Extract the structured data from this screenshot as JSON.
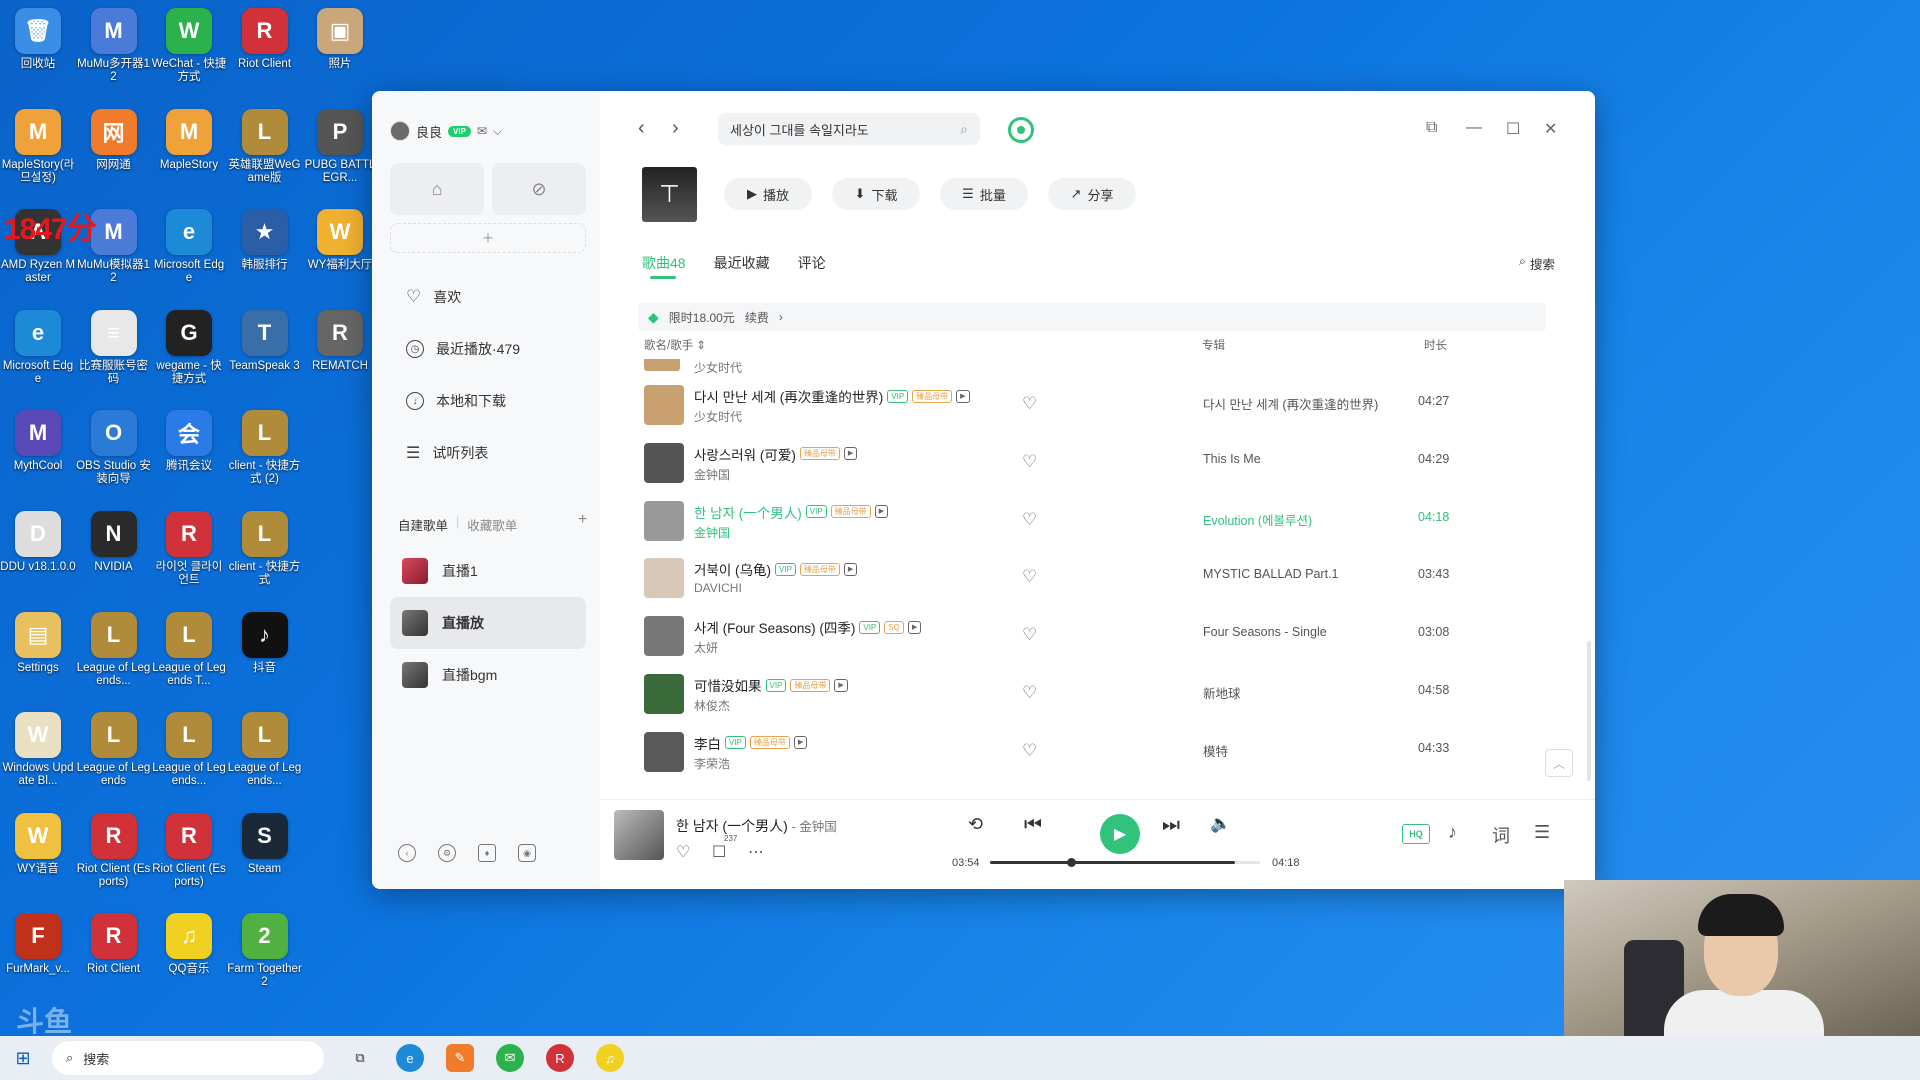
{
  "desktop": {
    "overlay_time": "1847分",
    "icons": [
      {
        "label": "回收站",
        "col": 0,
        "row": 0,
        "color": "#3a8ee6",
        "glyph": "🗑"
      },
      {
        "label": "MuMu多开器12",
        "col": 1,
        "row": 0,
        "color": "#4a7bd8",
        "glyph": "M"
      },
      {
        "label": "WeChat - 快捷方式",
        "col": 2,
        "row": 0,
        "color": "#2bb24c",
        "glyph": "W"
      },
      {
        "label": "Riot Client",
        "col": 3,
        "row": 0,
        "color": "#d1323a",
        "glyph": "R"
      },
      {
        "label": "照片",
        "col": 4,
        "row": 0,
        "color": "#c8a87a",
        "glyph": "▣"
      },
      {
        "label": "MapleStory(라므설정)",
        "col": 0,
        "row": 1,
        "color": "#f0a23a",
        "glyph": "M"
      },
      {
        "label": "网网通",
        "col": 1,
        "row": 1,
        "color": "#f07b2a",
        "glyph": "网"
      },
      {
        "label": "MapleStory",
        "col": 2,
        "row": 1,
        "color": "#f0a23a",
        "glyph": "M"
      },
      {
        "label": "英雄联盟WeGame版",
        "col": 3,
        "row": 1,
        "color": "#b08b3a",
        "glyph": "L"
      },
      {
        "label": "PUBG BATTLEGR...",
        "col": 4,
        "row": 1,
        "color": "#555",
        "glyph": "P"
      },
      {
        "label": "AMD Ryzen Master",
        "col": 0,
        "row": 2,
        "color": "#333",
        "glyph": "A"
      },
      {
        "label": "MuMu模拟器12",
        "col": 1,
        "row": 2,
        "color": "#4a7bd8",
        "glyph": "M"
      },
      {
        "label": "Microsoft Edge",
        "col": 2,
        "row": 2,
        "color": "#1d8ad8",
        "glyph": "e"
      },
      {
        "label": "韩服排行",
        "col": 3,
        "row": 2,
        "color": "#2a5fa8",
        "glyph": "★"
      },
      {
        "label": "WY福利大厅",
        "col": 4,
        "row": 2,
        "color": "#f0b030",
        "glyph": "W"
      },
      {
        "label": "Microsoft Edge",
        "col": 0,
        "row": 3,
        "color": "#1d8ad8",
        "glyph": "e"
      },
      {
        "label": "比赛服账号密码",
        "col": 1,
        "row": 3,
        "color": "#e8e8e8",
        "glyph": "≡"
      },
      {
        "label": "wegame - 快捷方式",
        "col": 2,
        "row": 3,
        "color": "#222",
        "glyph": "G"
      },
      {
        "label": "TeamSpeak 3",
        "col": 3,
        "row": 3,
        "color": "#3a6ea8",
        "glyph": "T"
      },
      {
        "label": "REMATCH",
        "col": 4,
        "row": 3,
        "color": "#666",
        "glyph": "R"
      },
      {
        "label": "MythCool",
        "col": 0,
        "row": 4,
        "color": "#5a4ab8",
        "glyph": "M"
      },
      {
        "label": "OBS Studio 安装向导",
        "col": 1,
        "row": 4,
        "color": "#2a7ad8",
        "glyph": "O"
      },
      {
        "label": "腾讯会议",
        "col": 2,
        "row": 4,
        "color": "#2a7ae8",
        "glyph": "会"
      },
      {
        "label": "client - 快捷方式 (2)",
        "col": 3,
        "row": 4,
        "color": "#b08b3a",
        "glyph": "L"
      },
      {
        "label": "DDU v18.1.0.0",
        "col": 0,
        "row": 5,
        "color": "#ddd",
        "glyph": "D"
      },
      {
        "label": "NVIDIA",
        "col": 1,
        "row": 5,
        "color": "#2a2a2a",
        "glyph": "N"
      },
      {
        "label": "라이엇 클라이언트",
        "col": 2,
        "row": 5,
        "color": "#d1323a",
        "glyph": "R"
      },
      {
        "label": "client - 快捷方式",
        "col": 3,
        "row": 5,
        "color": "#b08b3a",
        "glyph": "L"
      },
      {
        "label": "Settings",
        "col": 0,
        "row": 6,
        "color": "#e8c060",
        "glyph": "▤"
      },
      {
        "label": "League of Legends...",
        "col": 1,
        "row": 6,
        "color": "#b08b3a",
        "glyph": "L"
      },
      {
        "label": "League of Legends T...",
        "col": 2,
        "row": 6,
        "color": "#b08b3a",
        "glyph": "L"
      },
      {
        "label": "抖音",
        "col": 3,
        "row": 6,
        "color": "#111",
        "glyph": "♪"
      },
      {
        "label": "Windows Update Bl...",
        "col": 0,
        "row": 7,
        "color": "#e8e0c0",
        "glyph": "W"
      },
      {
        "label": "League of Legends",
        "col": 1,
        "row": 7,
        "color": "#b08b3a",
        "glyph": "L"
      },
      {
        "label": "League of Legends...",
        "col": 2,
        "row": 7,
        "color": "#b08b3a",
        "glyph": "L"
      },
      {
        "label": "League of Legends...",
        "col": 3,
        "row": 7,
        "color": "#b08b3a",
        "glyph": "L"
      },
      {
        "label": "WY语音",
        "col": 0,
        "row": 8,
        "color": "#f0c040",
        "glyph": "W"
      },
      {
        "label": "Riot Client (Esports)",
        "col": 1,
        "row": 8,
        "color": "#d1323a",
        "glyph": "R"
      },
      {
        "label": "Riot Client (Esports)",
        "col": 2,
        "row": 8,
        "color": "#d1323a",
        "glyph": "R"
      },
      {
        "label": "Steam",
        "col": 3,
        "row": 8,
        "color": "#1b2838",
        "glyph": "S"
      },
      {
        "label": "FurMark_v...",
        "col": 0,
        "row": 9,
        "color": "#c0301a",
        "glyph": "F"
      },
      {
        "label": "Riot Client",
        "col": 1,
        "row": 9,
        "color": "#d1323a",
        "glyph": "R"
      },
      {
        "label": "QQ音乐",
        "col": 2,
        "row": 9,
        "color": "#f0d020",
        "glyph": "♫"
      },
      {
        "label": "Farm Together 2",
        "col": 3,
        "row": 9,
        "color": "#50b040",
        "glyph": "2"
      }
    ]
  },
  "app": {
    "user": {
      "name": "良良",
      "vip": "VIP"
    },
    "side_menu": [
      {
        "label": "喜欢",
        "icon": "heart-icon"
      },
      {
        "label": "最近播放·479",
        "icon": "clock-icon"
      },
      {
        "label": "本地和下载",
        "icon": "download-icon"
      },
      {
        "label": "试听列表",
        "icon": "list-icon"
      }
    ],
    "playlist_tabs": {
      "own": "自建歌单",
      "collected": "收藏歌单"
    },
    "playlists": [
      {
        "label": "直播1",
        "thumb": "red"
      },
      {
        "label": "直播放",
        "thumb": "dark",
        "active": true
      },
      {
        "label": "直播bgm",
        "thumb": "dark"
      }
    ],
    "search": {
      "value": "세상이 그대를 속일지라도"
    },
    "actions": {
      "play": "播放",
      "download": "下载",
      "batch": "批量",
      "share": "分享"
    },
    "tabs": {
      "songs": "歌曲48",
      "recent": "最近收藏",
      "comments": "评论",
      "search": "搜索"
    },
    "promo": {
      "price": "限时18.00元",
      "renew": "续费"
    },
    "table_headers": {
      "song": "歌名/歌手",
      "album": "专辑",
      "duration": "时长"
    },
    "partial_row_artist": "少女时代",
    "songs": [
      {
        "title": "다시 만난 세계 (再次重逢的世界)",
        "artist": "少女时代",
        "album": "다시 만난 세계 (再次重逢的世界)",
        "duration": "04:27",
        "tags": [
          "VIP",
          "臻品母带",
          "MV"
        ],
        "cover": "#c9a070"
      },
      {
        "title": "사랑스러워 (可爱)",
        "artist": "金钟国",
        "album": "This Is Me",
        "duration": "04:29",
        "tags": [
          "臻品母带",
          "MV"
        ],
        "cover": "#555"
      },
      {
        "title": "한 남자 (一个男人)",
        "artist": "金钟国",
        "album": "Evolution (에볼루션)",
        "duration": "04:18",
        "tags": [
          "VIP",
          "臻品母带",
          "MV"
        ],
        "cover": "#999",
        "playing": true
      },
      {
        "title": "거북이 (乌龟)",
        "artist": "DAVICHI",
        "album": "MYSTIC BALLAD Part.1",
        "duration": "03:43",
        "tags": [
          "VIP",
          "臻品母带",
          "MV"
        ],
        "cover": "#d8c8b8"
      },
      {
        "title": "사계 (Four Seasons) (四季)",
        "artist": "太妍",
        "album": "Four Seasons - Single",
        "duration": "03:08",
        "tags": [
          "VIP",
          "SQ",
          "MV"
        ],
        "cover": "#777"
      },
      {
        "title": "可惜没如果",
        "artist": "林俊杰",
        "album": "新地球",
        "duration": "04:58",
        "tags": [
          "VIP",
          "臻品母带",
          "MV"
        ],
        "cover": "#3a6a3a"
      },
      {
        "title": "李白",
        "artist": "李荣浩",
        "album": "模特",
        "duration": "04:33",
        "tags": [
          "VIP",
          "臻品母带",
          "MV"
        ],
        "cover": "#5a5a5a"
      }
    ],
    "player": {
      "title": "한 남자 (一个男人)",
      "artist": "金钟国",
      "comments_count": "237",
      "current_time": "03:54",
      "total_time": "04:18",
      "progress": 0.907,
      "volume_position": 0.3,
      "quality": "HQ"
    }
  },
  "taskbar": {
    "search_placeholder": "搜索"
  },
  "colors": {
    "accent": "#31c27c",
    "desktop": "#0b72de"
  }
}
